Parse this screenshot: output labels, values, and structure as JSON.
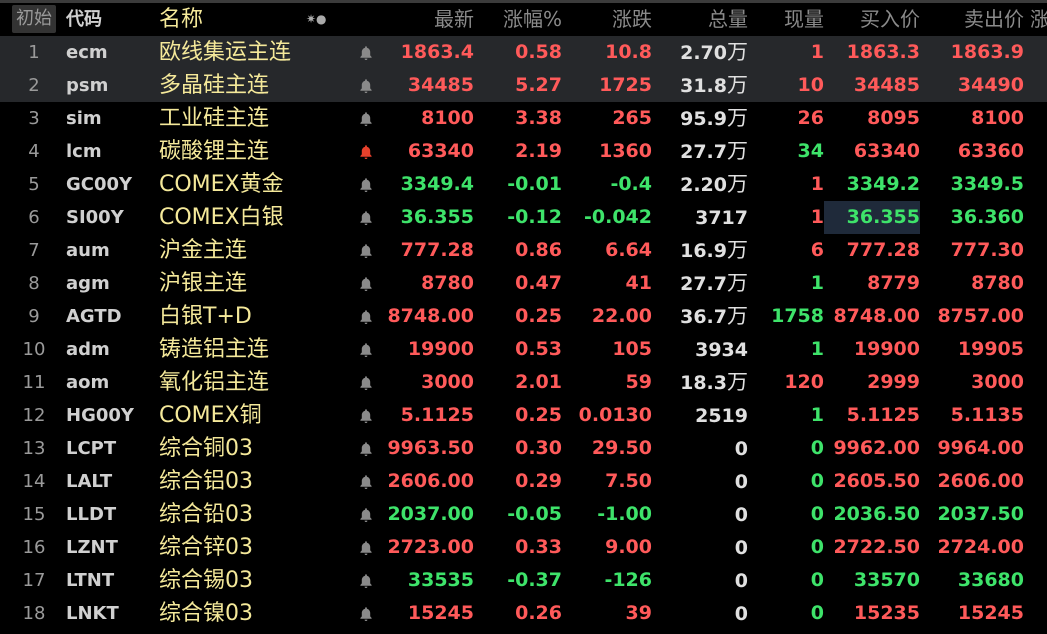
{
  "header": {
    "index_label": "初始",
    "code": "代码",
    "name": "名称",
    "star": "✷●",
    "last": "最新",
    "pct": "涨幅%",
    "chg": "涨跌",
    "vol": "总量",
    "cur": "现量",
    "bid": "买入价",
    "ask": "卖出价",
    "more": "涨"
  },
  "colors": {
    "up": "#ff5a5a",
    "down": "#3ee36a",
    "name": "#f5e99a",
    "alert_bell": "#e8412c"
  },
  "rows": [
    {
      "idx": "1",
      "code": "ecm",
      "name": "欧线集运主连",
      "bell": "bell-icon",
      "last": "1863.4",
      "pct": "0.58",
      "chg": "10.8",
      "vol": "2.70",
      "vol_unit": "万",
      "cur": "1",
      "bid": "1863.3",
      "ask": "1863.9",
      "dir": "up",
      "cur_dir": "up"
    },
    {
      "idx": "2",
      "code": "psm",
      "name": "多晶硅主连",
      "bell": "bell-icon",
      "last": "34485",
      "pct": "5.27",
      "chg": "1725",
      "vol": "31.8",
      "vol_unit": "万",
      "cur": "10",
      "bid": "34485",
      "ask": "34490",
      "dir": "up",
      "cur_dir": "up"
    },
    {
      "idx": "3",
      "code": "sim",
      "name": "工业硅主连",
      "bell": "bell-icon",
      "last": "8100",
      "pct": "3.38",
      "chg": "265",
      "vol": "95.9",
      "vol_unit": "万",
      "cur": "26",
      "bid": "8095",
      "ask": "8100",
      "dir": "up",
      "cur_dir": "up"
    },
    {
      "idx": "4",
      "code": "lcm",
      "name": "碳酸锂主连",
      "bell": "bell-alert-icon",
      "last": "63340",
      "pct": "2.19",
      "chg": "1360",
      "vol": "27.7",
      "vol_unit": "万",
      "cur": "34",
      "bid": "63340",
      "ask": "63360",
      "dir": "up",
      "cur_dir": "down"
    },
    {
      "idx": "5",
      "code": "GC00Y",
      "name": "COMEX黄金",
      "bell": "bell-icon",
      "last": "3349.4",
      "pct": "-0.01",
      "chg": "-0.4",
      "vol": "2.20",
      "vol_unit": "万",
      "cur": "1",
      "bid": "3349.2",
      "ask": "3349.5",
      "dir": "down",
      "cur_dir": "up"
    },
    {
      "idx": "6",
      "code": "SI00Y",
      "name": "COMEX白银",
      "bell": "bell-icon",
      "last": "36.355",
      "pct": "-0.12",
      "chg": "-0.042",
      "vol": "3717",
      "vol_unit": "",
      "cur": "1",
      "bid": "36.355",
      "ask": "36.360",
      "dir": "down",
      "cur_dir": "up"
    },
    {
      "idx": "7",
      "code": "aum",
      "name": "沪金主连",
      "bell": "bell-icon",
      "last": "777.28",
      "pct": "0.86",
      "chg": "6.64",
      "vol": "16.9",
      "vol_unit": "万",
      "cur": "6",
      "bid": "777.28",
      "ask": "777.30",
      "dir": "up",
      "cur_dir": "up"
    },
    {
      "idx": "8",
      "code": "agm",
      "name": "沪银主连",
      "bell": "bell-icon",
      "last": "8780",
      "pct": "0.47",
      "chg": "41",
      "vol": "27.7",
      "vol_unit": "万",
      "cur": "1",
      "bid": "8779",
      "ask": "8780",
      "dir": "up",
      "cur_dir": "down"
    },
    {
      "idx": "9",
      "code": "AGTD",
      "name": "白银T+D",
      "bell": "bell-icon",
      "last": "8748.00",
      "pct": "0.25",
      "chg": "22.00",
      "vol": "36.7",
      "vol_unit": "万",
      "cur": "1758",
      "bid": "8748.00",
      "ask": "8757.00",
      "dir": "up",
      "cur_dir": "down"
    },
    {
      "idx": "10",
      "code": "adm",
      "name": "铸造铝主连",
      "bell": "bell-icon",
      "last": "19900",
      "pct": "0.53",
      "chg": "105",
      "vol": "3934",
      "vol_unit": "",
      "cur": "1",
      "bid": "19900",
      "ask": "19905",
      "dir": "up",
      "cur_dir": "down"
    },
    {
      "idx": "11",
      "code": "aom",
      "name": "氧化铝主连",
      "bell": "bell-icon",
      "last": "3000",
      "pct": "2.01",
      "chg": "59",
      "vol": "18.3",
      "vol_unit": "万",
      "cur": "120",
      "bid": "2999",
      "ask": "3000",
      "dir": "up",
      "cur_dir": "up"
    },
    {
      "idx": "12",
      "code": "HG00Y",
      "name": "COMEX铜",
      "bell": "bell-icon",
      "last": "5.1125",
      "pct": "0.25",
      "chg": "0.0130",
      "vol": "2519",
      "vol_unit": "",
      "cur": "1",
      "bid": "5.1125",
      "ask": "5.1135",
      "dir": "up",
      "cur_dir": "down"
    },
    {
      "idx": "13",
      "code": "LCPT",
      "name": "综合铜03",
      "bell": "bell-icon",
      "last": "9963.50",
      "pct": "0.30",
      "chg": "29.50",
      "vol": "0",
      "vol_unit": "",
      "cur": "0",
      "bid": "9962.00",
      "ask": "9964.00",
      "dir": "up",
      "cur_dir": "down"
    },
    {
      "idx": "14",
      "code": "LALT",
      "name": "综合铝03",
      "bell": "bell-icon",
      "last": "2606.00",
      "pct": "0.29",
      "chg": "7.50",
      "vol": "0",
      "vol_unit": "",
      "cur": "0",
      "bid": "2605.50",
      "ask": "2606.00",
      "dir": "up",
      "cur_dir": "down"
    },
    {
      "idx": "15",
      "code": "LLDT",
      "name": "综合铅03",
      "bell": "bell-icon",
      "last": "2037.00",
      "pct": "-0.05",
      "chg": "-1.00",
      "vol": "0",
      "vol_unit": "",
      "cur": "0",
      "bid": "2036.50",
      "ask": "2037.50",
      "dir": "down",
      "cur_dir": "down"
    },
    {
      "idx": "16",
      "code": "LZNT",
      "name": "综合锌03",
      "bell": "bell-icon",
      "last": "2723.00",
      "pct": "0.33",
      "chg": "9.00",
      "vol": "0",
      "vol_unit": "",
      "cur": "0",
      "bid": "2722.50",
      "ask": "2724.00",
      "dir": "up",
      "cur_dir": "down"
    },
    {
      "idx": "17",
      "code": "LTNT",
      "name": "综合锡03",
      "bell": "bell-icon",
      "last": "33535",
      "pct": "-0.37",
      "chg": "-126",
      "vol": "0",
      "vol_unit": "",
      "cur": "0",
      "bid": "33570",
      "ask": "33680",
      "dir": "down",
      "cur_dir": "down"
    },
    {
      "idx": "18",
      "code": "LNKT",
      "name": "综合镍03",
      "bell": "bell-icon",
      "last": "15245",
      "pct": "0.26",
      "chg": "39",
      "vol": "0",
      "vol_unit": "",
      "cur": "0",
      "bid": "15235",
      "ask": "15245",
      "dir": "up",
      "cur_dir": "down"
    }
  ]
}
